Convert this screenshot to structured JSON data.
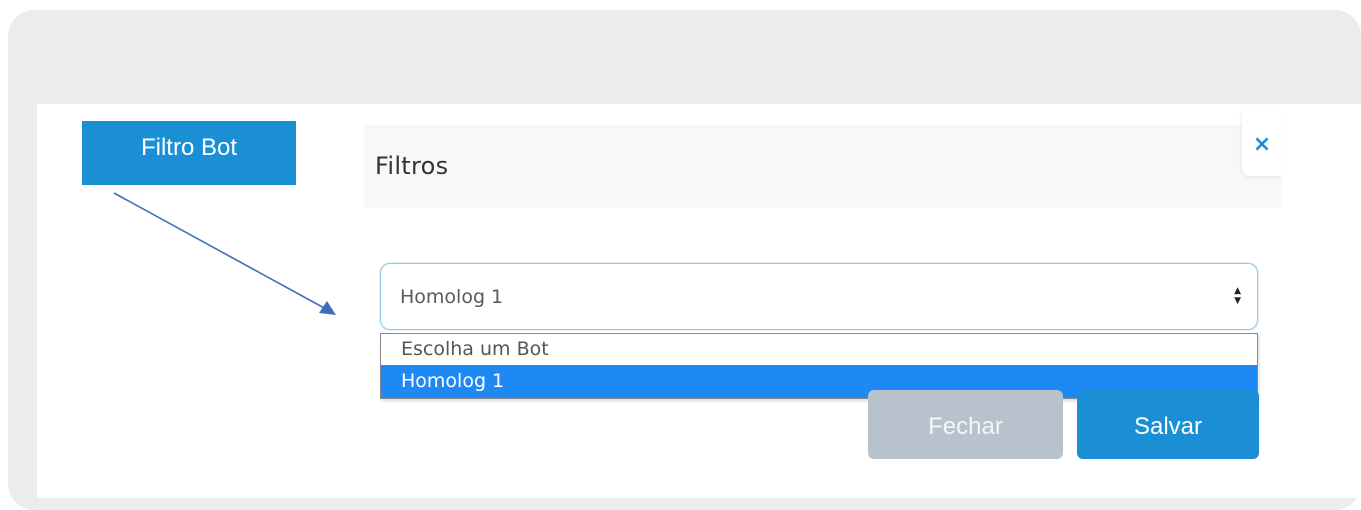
{
  "annotation": {
    "label": "Filtro Bot"
  },
  "modal": {
    "title": "Filtros",
    "close_icon": "×",
    "select": {
      "value": "Homolog 1",
      "caret_up": "▲",
      "caret_down": "▼",
      "options": [
        {
          "label": "Escolha um Bot",
          "selected": false
        },
        {
          "label": "Homolog 1",
          "selected": true
        }
      ]
    },
    "buttons": {
      "close_label": "Fechar",
      "save_label": "Salvar"
    }
  },
  "colors": {
    "accent": "#1a8fd6",
    "option_highlight": "#1e88f5",
    "secondary_button": "#b7c2cc",
    "frame": "#ececec"
  }
}
